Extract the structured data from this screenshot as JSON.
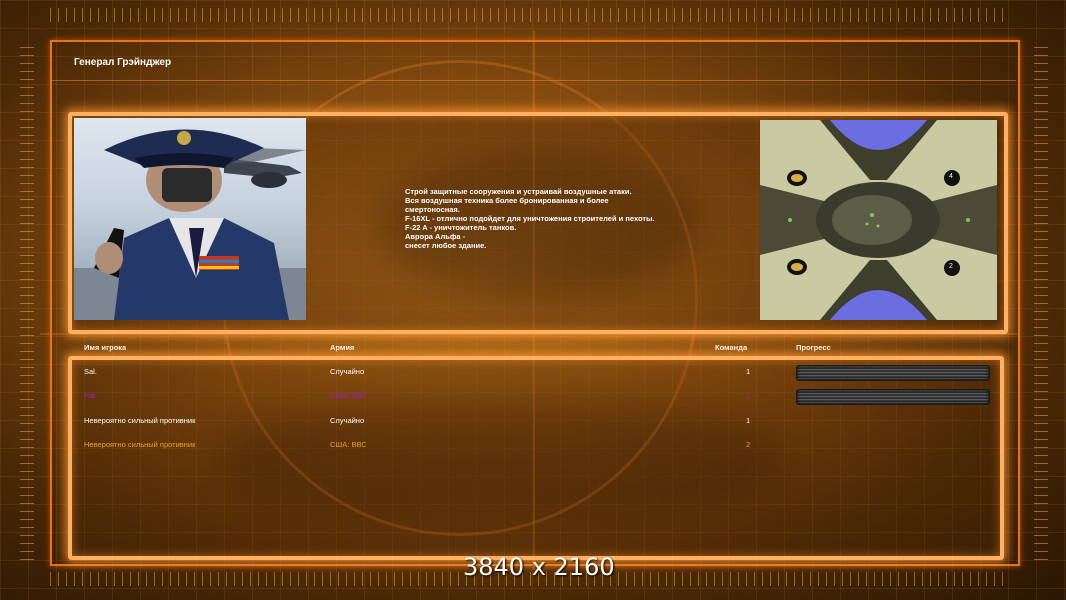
{
  "header": {
    "title": "Генерал Грэйнджер"
  },
  "briefing": {
    "lines": [
      "Строй защитные сооружения и устраивай воздушные атаки.",
      "Вся воздушная техника более бронированная и более",
      "смертоносная.",
      "F-16XL - отлично подойдет для уничтожения строителей и пехоты.",
      "F-22 A - уничтожитель танков.",
      "Аврора Альфа -",
      "снесет любое здание."
    ]
  },
  "minimap": {
    "start_labels": [
      "4",
      "2"
    ]
  },
  "player_table": {
    "headers": {
      "name": "Имя игрока",
      "army": "Армия",
      "team": "Команда",
      "progress": "Прогресс"
    },
    "rows": [
      {
        "name": "Sal.",
        "army": "Случайно",
        "team": "1",
        "color": "#ffffff",
        "progress": 1.0
      },
      {
        "name": "Pat",
        "army": "США: ВВС",
        "team": "2",
        "color": "#9a20c8",
        "progress": 1.0
      },
      {
        "name": "Невероятно сильный противник",
        "army": "Случайно",
        "team": "1",
        "color": "#ffffff"
      },
      {
        "name": "Невероятно сильный противник",
        "army": "США: ВВС",
        "team": "2",
        "color": "#f0a020"
      }
    ]
  },
  "overlay": {
    "resolution": "3840 x 2160"
  },
  "colors": {
    "frame": "#e8731a",
    "panel_border": "#ffb060"
  }
}
